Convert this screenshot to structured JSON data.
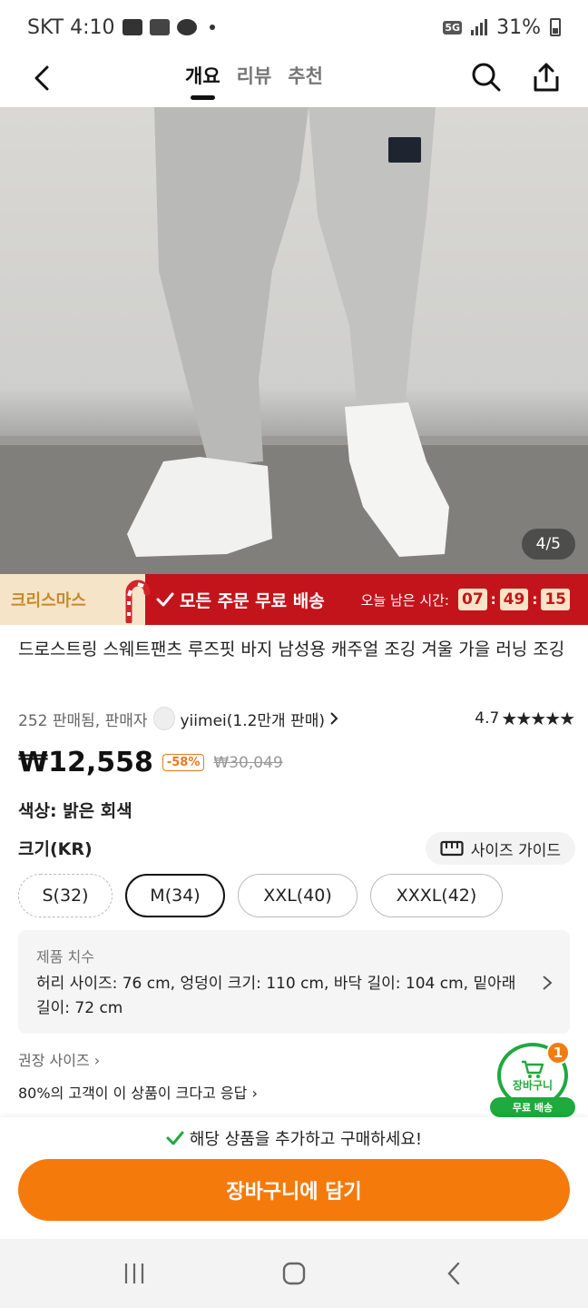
{
  "status_bar": {
    "carrier_time": "SKT 4:10",
    "network": "5G",
    "battery": "31%"
  },
  "header": {
    "tabs": [
      "개요",
      "리뷰",
      "추천"
    ],
    "active_tab": "개요"
  },
  "gallery": {
    "counter": "4/5"
  },
  "promo": {
    "label": "크리스마스",
    "message": "모든 주문 무료 배송",
    "timer_label": "오늘 남은 시간:",
    "hours": "07",
    "minutes": "49",
    "seconds": "15"
  },
  "product": {
    "title": "드로스트링 스웨트팬츠 루즈핏 바지 남성용 캐주얼 조깅 겨울 가을 러닝 조깅",
    "sold_text": "252 판매됨, 판매자",
    "seller": "yiimei(1.2만개 판매)",
    "rating": "4.7",
    "stars": "★★★★★",
    "price": "₩12,558",
    "discount": "-58%",
    "old_price": "₩30,049",
    "color_line": "색상: 밝은 회색",
    "size_label": "크기(KR)",
    "size_guide": "사이즈 가이드",
    "sizes": [
      "S(32)",
      "M(34)",
      "XXL(40)",
      "XXXL(42)"
    ],
    "selected_size": "M(34)",
    "dims_title": "제품 치수",
    "dims_text": "허리 사이즈: 76 cm, 엉덩이 크기: 110 cm, 바닥 길이: 104 cm, 밑아래 길이: 72 cm",
    "rec_size": "권장 사이즈",
    "rec_reply": "80%의 고객이 이 상품이 크다고 응답"
  },
  "cart": {
    "label": "장바구니",
    "count": "1",
    "free_shipping": "무료 배송"
  },
  "bottom": {
    "notice": "해당 상품을 추가하고 구매하세요!",
    "add_to_cart": "장바구니에 담기"
  },
  "colors": {
    "accent": "#f57a0c",
    "promo_red": "#c4141b",
    "cart_green": "#1eaa3c"
  }
}
